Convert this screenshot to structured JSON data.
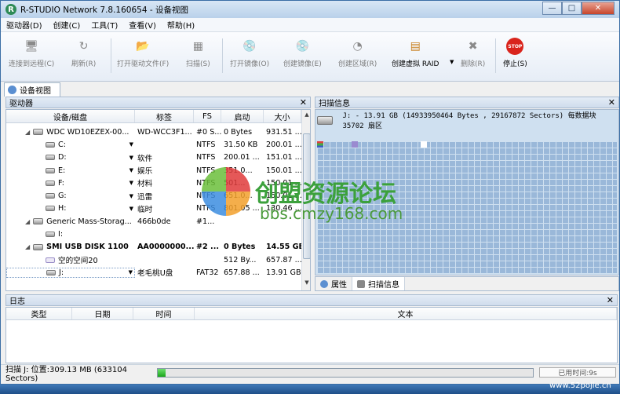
{
  "window": {
    "title": "R-STUDIO Network 7.8.160654 - 设备视图",
    "icon": "rstudio-icon"
  },
  "window_buttons": {
    "minimize": "—",
    "maximize": "□",
    "close": "✕"
  },
  "menu": [
    "驱动器(D)",
    "创建(C)",
    "工具(T)",
    "查看(V)",
    "帮助(H)"
  ],
  "toolbar": [
    {
      "label": "连接到远程(C)",
      "icon": "remote-computer-icon",
      "enabled": false
    },
    {
      "label": "刷新(R)",
      "icon": "refresh-icon",
      "enabled": false
    },
    {
      "label": "打开驱动文件(F)",
      "icon": "open-file-icon",
      "enabled": false
    },
    {
      "label": "扫描(S)",
      "icon": "scan-icon",
      "enabled": false
    },
    {
      "label": "打开镜像(O)",
      "icon": "open-image-icon",
      "enabled": false
    },
    {
      "label": "创建镜像(E)",
      "icon": "create-image-icon",
      "enabled": false
    },
    {
      "label": "创建区域(R)",
      "icon": "create-region-icon",
      "enabled": false
    },
    {
      "label": "创建虚拟 RAID",
      "icon": "virtual-raid-icon",
      "enabled": true
    },
    {
      "label": "删除(R)",
      "icon": "delete-icon",
      "enabled": false
    },
    {
      "label": "停止(S)",
      "icon": "stop-icon",
      "enabled": true
    }
  ],
  "stop_icon_text": "STOP",
  "doc_tab": "设备视图",
  "drives_pane": {
    "title": "驱动器",
    "columns": [
      "设备/磁盘",
      "标签",
      "FS",
      "启动",
      "大小"
    ],
    "rows": [
      {
        "name": "WDC WD10EZEX-00...",
        "label": "WD-WCC3F1...",
        "fs": "#0 S...",
        "start": "0 Bytes",
        "size": "931.51 ...",
        "level": 0,
        "bold": false
      },
      {
        "name": "C:",
        "label": "",
        "fs": "NTFS",
        "start": "31.50 KB",
        "size": "200.01 ...",
        "level": 1,
        "bold": false
      },
      {
        "name": "D:",
        "label": "软件",
        "fs": "NTFS",
        "start": "200.01 ...",
        "size": "151.01 ...",
        "level": 1,
        "bold": false
      },
      {
        "name": "E:",
        "label": "娱乐",
        "fs": "NTFS",
        "start": "351.0...",
        "size": "150.01 ...",
        "level": 1,
        "bold": false
      },
      {
        "name": "F:",
        "label": "材料",
        "fs": "NTFS",
        "start": "501...",
        "size": "150.01 ...",
        "level": 1,
        "bold": false
      },
      {
        "name": "G:",
        "label": "迅雷",
        "fs": "NTFS",
        "start": "651.0...",
        "size": "150.01 ...",
        "level": 1,
        "bold": false
      },
      {
        "name": "H:",
        "label": "临时",
        "fs": "NTFS",
        "start": "801.05 ...",
        "size": "130.46 ...",
        "level": 1,
        "bold": false
      },
      {
        "name": "Generic Mass-Storag...",
        "label": "466b0de",
        "fs": "#1...",
        "start": "",
        "size": "",
        "level": 0,
        "bold": false
      },
      {
        "name": "I:",
        "label": "",
        "fs": "",
        "start": "",
        "size": "",
        "level": 1,
        "bold": false
      },
      {
        "name": "SMI USB DISK 1100",
        "label": "AA0000000...",
        "fs": "#2 ...",
        "start": "0 Bytes",
        "size": "14.55 GB",
        "level": 0,
        "bold": true
      },
      {
        "name": "空的空间20",
        "label": "",
        "fs": "",
        "start": "512 By...",
        "size": "657.87 ...",
        "level": 1,
        "bold": false
      },
      {
        "name": "J:",
        "label": "老毛桃U盘",
        "fs": "FAT32",
        "start": "657.88 ...",
        "size": "13.91 GB",
        "level": 1,
        "bold": false
      }
    ]
  },
  "scan_pane": {
    "title": "扫描信息",
    "info": "J: - 13.91 GB (14933950464 Bytes , 29167872 Sectors) 每数据块 35702 扇区"
  },
  "right_tabs": [
    "属性",
    "扫描信息"
  ],
  "log_pane": {
    "title": "日志",
    "columns": [
      "类型",
      "日期",
      "时间",
      "文本"
    ]
  },
  "status": {
    "text": "扫描 J: 位置:309.13 MB (633104 Sectors)",
    "progress_fraction": 0.02,
    "time": "已用时间:9s"
  },
  "watermarks": {
    "cn": "创盟资源论坛",
    "url": "bbs.cmzy168.com",
    "corner": "www.52pojie.cn"
  },
  "colors": {
    "accent": "#3c8de0",
    "progress": "#22b022"
  }
}
